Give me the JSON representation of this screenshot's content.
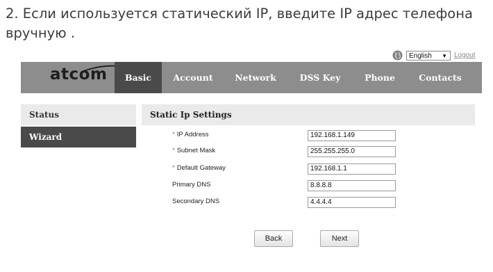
{
  "instruction": "2. Если используется статический IP, введите IP адрес телефона вручную .",
  "header": {
    "language": "English",
    "logout": "Logout",
    "logo": "atcom"
  },
  "nav": {
    "tabs": [
      "Basic",
      "Account",
      "Network",
      "DSS Key",
      "Phone",
      "Contacts"
    ],
    "active": "Basic"
  },
  "sidebar": {
    "items": [
      "Status",
      "Wizard"
    ],
    "active": "Wizard"
  },
  "form": {
    "title": "Static Ip Settings",
    "fields": [
      {
        "label": "IP Address",
        "required": "*",
        "value": "192.168.1.149"
      },
      {
        "label": "Subnet Mask",
        "required": "*",
        "value": "255.255.255.0"
      },
      {
        "label": "Default Gateway",
        "required": "*",
        "value": "192.168.1.1"
      },
      {
        "label": "Primary DNS",
        "required": "",
        "value": "8.8.8.8"
      },
      {
        "label": "Secondary DNS",
        "required": "",
        "value": "4.4.4.4"
      }
    ],
    "back_label": "Back",
    "next_label": "Next"
  },
  "colors": {
    "navbar": "#8d8d8d",
    "active": "#4a4a4a",
    "panel": "#eaeaea"
  }
}
